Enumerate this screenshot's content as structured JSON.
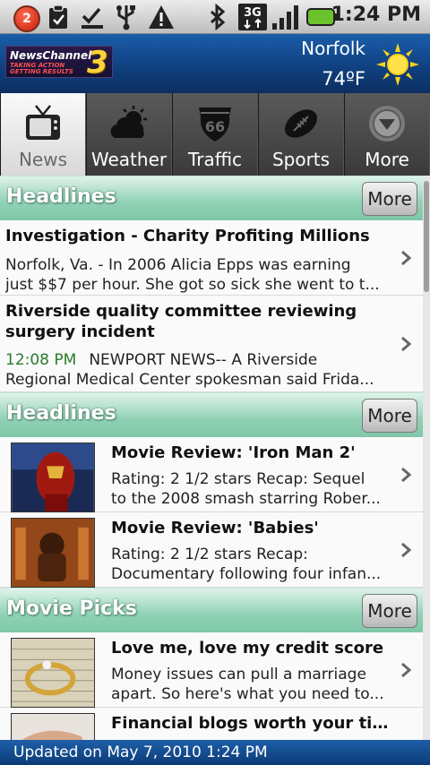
{
  "status_bar": {
    "notification_count": "2",
    "time": "1:24 PM",
    "icons": [
      "notification-badge",
      "clipboard-icon",
      "download-done-icon",
      "usb-icon",
      "warning-icon",
      "bluetooth-icon",
      "3g-icon",
      "signal-icon",
      "battery-icon"
    ]
  },
  "header": {
    "logo_text": "NewsChannel",
    "logo_sub_line1": "TAKING ACTION",
    "logo_sub_line2": "GETTING RESULTS",
    "logo_number": "3",
    "city": "Norfolk",
    "temperature": "74ºF",
    "weather_icon": "sun-icon"
  },
  "tabs": [
    {
      "label": "News",
      "icon": "tv-icon",
      "active": true
    },
    {
      "label": "Weather",
      "icon": "cloud-sun-icon",
      "active": false
    },
    {
      "label": "Traffic",
      "icon": "route-66-icon",
      "active": false
    },
    {
      "label": "Sports",
      "icon": "football-icon",
      "active": false
    },
    {
      "label": "More",
      "icon": "chevron-circle-icon",
      "active": false
    }
  ],
  "sections": [
    {
      "title": "Headlines",
      "more_label": "More",
      "items": [
        {
          "headline": "Investigation - Charity Profiting Millions",
          "snippet_line1": "Norfolk, Va. - In 2006 Alicia Epps was earning",
          "snippet_line2": "just $$7 per hour. She got so sick she went to t..."
        },
        {
          "headline_line1": "Riverside quality committee reviewing",
          "headline_line2": "surgery incident",
          "timestamp": "12:08 PM",
          "snippet_line1": "NEWPORT NEWS-- A Riverside",
          "snippet_line2": "Regional Medical Center spokesman said Frida..."
        }
      ]
    },
    {
      "title": "Headlines",
      "more_label": "More",
      "items": [
        {
          "headline": "Movie Review: 'Iron Man 2'",
          "snippet_line1": "Rating: 2 1/2 stars Recap: Sequel",
          "snippet_line2": "to the 2008 smash starring Rober..."
        },
        {
          "headline": "Movie Review: 'Babies'",
          "snippet_line1": "Rating: 2 1/2 stars Recap:",
          "snippet_line2": "Documentary following four infan..."
        }
      ]
    },
    {
      "title": "Movie Picks",
      "more_label": "More",
      "items": [
        {
          "headline": "Love me, love my credit score",
          "snippet_line1": "Money issues can pull a marriage",
          "snippet_line2": "apart. So here's what you need to..."
        },
        {
          "headline": "Financial blogs worth your time"
        }
      ]
    }
  ],
  "footer": {
    "updated": "Updated on May 7, 2010 1:24 PM"
  },
  "colors": {
    "header_blue": "#0f3f7d",
    "section_green": "#8fd1b5",
    "timestamp_green": "#2c7a2c"
  }
}
